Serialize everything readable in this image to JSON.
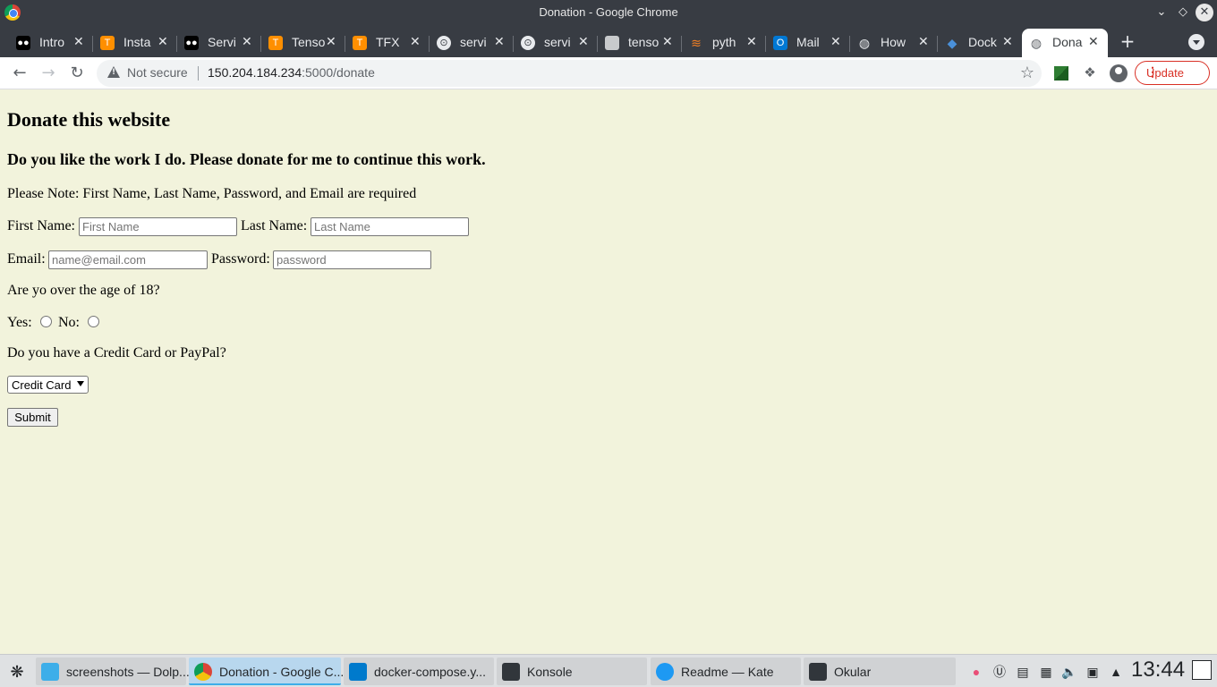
{
  "window": {
    "title": "Donation - Google Chrome"
  },
  "tabs": [
    {
      "label": "Intro",
      "icon": "medium-icon",
      "color": "#000000"
    },
    {
      "label": "Insta",
      "icon": "tensorflow-icon",
      "color": "#ff8f00"
    },
    {
      "label": "Servi",
      "icon": "medium-icon",
      "color": "#000000"
    },
    {
      "label": "Tenso",
      "icon": "tensorflow-icon",
      "color": "#ff8f00"
    },
    {
      "label": "TFX",
      "icon": "tensorflow-icon",
      "color": "#ff8f00"
    },
    {
      "label": "servi",
      "icon": "github-icon",
      "color": "#ffffff"
    },
    {
      "label": "servi",
      "icon": "github-icon",
      "color": "#ffffff"
    },
    {
      "label": "tenso",
      "icon": "box-icon",
      "color": "#e8eaed"
    },
    {
      "label": "pyth",
      "icon": "stackoverflow-icon",
      "color": "#f48024"
    },
    {
      "label": "Mail",
      "icon": "outlook-icon",
      "color": "#0078d4"
    },
    {
      "label": "How",
      "icon": "globe-icon",
      "color": "#e8eaed"
    },
    {
      "label": "Dock",
      "icon": "gitlab-icon",
      "color": "#4a90d9"
    },
    {
      "label": "Dona",
      "icon": "globe-icon",
      "color": "#5f6368",
      "active": true
    }
  ],
  "toolbar": {
    "security_label": "Not secure",
    "url_host": "150.204.184.234",
    "url_path": ":5000/donate",
    "update_label": "Update"
  },
  "page": {
    "heading": "Donate this website",
    "subheading": "Do you like the work I do. Please donate for me to continue this work.",
    "note": "Please Note: First Name, Last Name, Password, and Email are required",
    "first_name_label": "First Name:",
    "first_name_placeholder": "First Name",
    "last_name_label": "Last Name:",
    "last_name_placeholder": "Last Name",
    "email_label": "Email:",
    "email_placeholder": "name@email.com",
    "password_label": "Password:",
    "password_placeholder": "password",
    "age_question": "Are yo over the age of 18?",
    "yes_label": "Yes:",
    "no_label": "No:",
    "payment_question": "Do you have a Credit Card or PayPal?",
    "payment_selected": "Credit Card",
    "submit_label": "Submit"
  },
  "taskbar": {
    "tasks": [
      {
        "label": "screenshots — Dolp...",
        "icon": "folder-icon",
        "color": "#3daee9"
      },
      {
        "label": "Donation - Google C...",
        "icon": "chrome-icon",
        "color": "#db4437",
        "active": true
      },
      {
        "label": "docker-compose.y...",
        "icon": "vscode-icon",
        "color": "#007acc"
      },
      {
        "label": "Konsole",
        "icon": "terminal-icon",
        "color": "#31363b"
      },
      {
        "label": "Readme  — Kate",
        "icon": "kate-icon",
        "color": "#1d99f3"
      },
      {
        "label": "Okular",
        "icon": "okular-icon",
        "color": "#31363b"
      }
    ],
    "clock": "13:44"
  }
}
